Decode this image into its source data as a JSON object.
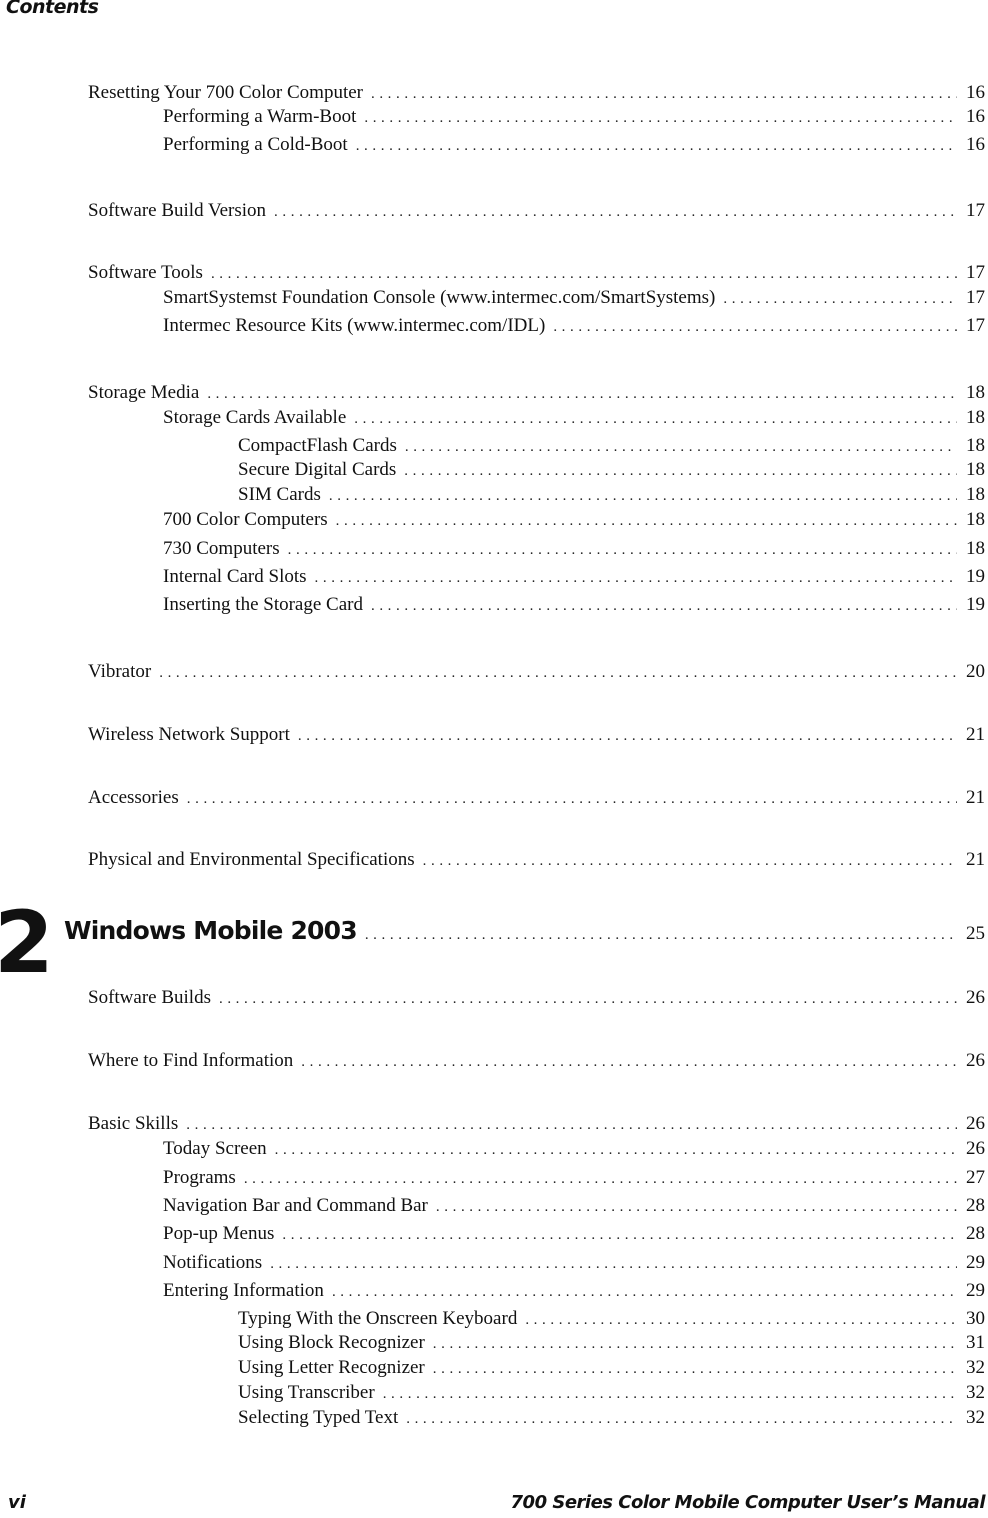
{
  "header": {
    "title": "Contents"
  },
  "chapter": {
    "number": "2",
    "title": "Windows Mobile 2003",
    "page": "25"
  },
  "entries": [
    {
      "level": 1,
      "title": "Resetting Your 700 Color Computer",
      "page": "16"
    },
    {
      "level": 2,
      "title": "Performing a Warm-Boot",
      "page": "16"
    },
    {
      "level": 2,
      "title": "Performing a Cold-Boot",
      "page": "16"
    },
    {
      "level": 1,
      "title": "Software Build Version",
      "page": "17"
    },
    {
      "level": 1,
      "title": "Software Tools",
      "page": "17"
    },
    {
      "level": 2,
      "title": "SmartSystemst Foundation Console (www.intermec.com/SmartSystems)",
      "page": "17"
    },
    {
      "level": 2,
      "title": "Intermec Resource Kits (www.intermec.com/IDL)",
      "page": "17"
    },
    {
      "level": 1,
      "title": "Storage Media",
      "page": "18"
    },
    {
      "level": 2,
      "title": "Storage Cards Available",
      "page": "18"
    },
    {
      "level": 3,
      "title": "CompactFlash Cards",
      "page": "18"
    },
    {
      "level": 3,
      "title": "Secure Digital Cards",
      "page": "18"
    },
    {
      "level": 3,
      "title": "SIM Cards",
      "page": "18"
    },
    {
      "level": 2,
      "title": "700 Color Computers",
      "page": "18"
    },
    {
      "level": 2,
      "title": "730 Computers",
      "page": "18"
    },
    {
      "level": 2,
      "title": "Internal Card Slots",
      "page": "19"
    },
    {
      "level": 2,
      "title": "Inserting the Storage Card",
      "page": "19"
    },
    {
      "level": 1,
      "title": "Vibrator",
      "page": "20"
    },
    {
      "level": 1,
      "title": "Wireless Network Support",
      "page": "21"
    },
    {
      "level": 1,
      "title": "Accessories",
      "page": "21"
    },
    {
      "level": 1,
      "title": "Physical and Environmental Specifications",
      "page": "21"
    },
    {
      "level": 1,
      "title": "Software Builds",
      "page": "26"
    },
    {
      "level": 1,
      "title": "Where to Find Information",
      "page": "26"
    },
    {
      "level": 1,
      "title": "Basic Skills",
      "page": "26"
    },
    {
      "level": 2,
      "title": "Today Screen",
      "page": "26"
    },
    {
      "level": 2,
      "title": "Programs",
      "page": "27"
    },
    {
      "level": 2,
      "title": "Navigation Bar and Command Bar",
      "page": "28"
    },
    {
      "level": 2,
      "title": "Pop-up Menus",
      "page": "28"
    },
    {
      "level": 2,
      "title": "Notifications",
      "page": "29"
    },
    {
      "level": 2,
      "title": "Entering Information",
      "page": "29"
    },
    {
      "level": 3,
      "title": "Typing With the Onscreen Keyboard",
      "page": "30"
    },
    {
      "level": 3,
      "title": "Using Block Recognizer",
      "page": "31"
    },
    {
      "level": 3,
      "title": "Using Letter Recognizer",
      "page": "32"
    },
    {
      "level": 3,
      "title": "Using Transcriber",
      "page": "32"
    },
    {
      "level": 3,
      "title": "Selecting Typed Text",
      "page": "32"
    }
  ],
  "footer": {
    "page_label": "vi",
    "manual_title": "700 Series Color Mobile Computer User’s Manual"
  }
}
